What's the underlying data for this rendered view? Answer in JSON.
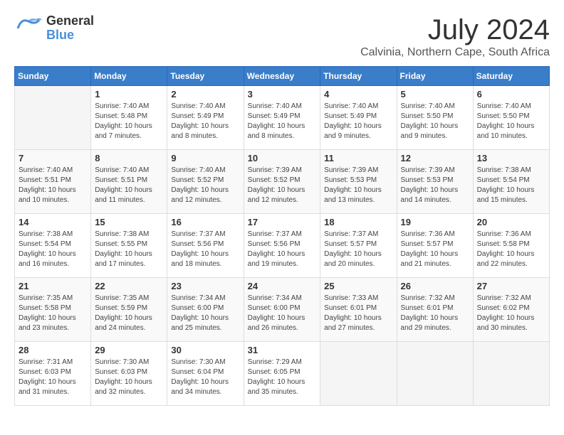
{
  "logo": {
    "general": "General",
    "blue": "Blue"
  },
  "title": {
    "month_year": "July 2024",
    "location": "Calvinia, Northern Cape, South Africa"
  },
  "headers": [
    "Sunday",
    "Monday",
    "Tuesday",
    "Wednesday",
    "Thursday",
    "Friday",
    "Saturday"
  ],
  "weeks": [
    [
      {
        "day": "",
        "info": ""
      },
      {
        "day": "1",
        "info": "Sunrise: 7:40 AM\nSunset: 5:48 PM\nDaylight: 10 hours\nand 7 minutes."
      },
      {
        "day": "2",
        "info": "Sunrise: 7:40 AM\nSunset: 5:49 PM\nDaylight: 10 hours\nand 8 minutes."
      },
      {
        "day": "3",
        "info": "Sunrise: 7:40 AM\nSunset: 5:49 PM\nDaylight: 10 hours\nand 8 minutes."
      },
      {
        "day": "4",
        "info": "Sunrise: 7:40 AM\nSunset: 5:49 PM\nDaylight: 10 hours\nand 9 minutes."
      },
      {
        "day": "5",
        "info": "Sunrise: 7:40 AM\nSunset: 5:50 PM\nDaylight: 10 hours\nand 9 minutes."
      },
      {
        "day": "6",
        "info": "Sunrise: 7:40 AM\nSunset: 5:50 PM\nDaylight: 10 hours\nand 10 minutes."
      }
    ],
    [
      {
        "day": "7",
        "info": "Sunrise: 7:40 AM\nSunset: 5:51 PM\nDaylight: 10 hours\nand 10 minutes."
      },
      {
        "day": "8",
        "info": "Sunrise: 7:40 AM\nSunset: 5:51 PM\nDaylight: 10 hours\nand 11 minutes."
      },
      {
        "day": "9",
        "info": "Sunrise: 7:40 AM\nSunset: 5:52 PM\nDaylight: 10 hours\nand 12 minutes."
      },
      {
        "day": "10",
        "info": "Sunrise: 7:39 AM\nSunset: 5:52 PM\nDaylight: 10 hours\nand 12 minutes."
      },
      {
        "day": "11",
        "info": "Sunrise: 7:39 AM\nSunset: 5:53 PM\nDaylight: 10 hours\nand 13 minutes."
      },
      {
        "day": "12",
        "info": "Sunrise: 7:39 AM\nSunset: 5:53 PM\nDaylight: 10 hours\nand 14 minutes."
      },
      {
        "day": "13",
        "info": "Sunrise: 7:38 AM\nSunset: 5:54 PM\nDaylight: 10 hours\nand 15 minutes."
      }
    ],
    [
      {
        "day": "14",
        "info": "Sunrise: 7:38 AM\nSunset: 5:54 PM\nDaylight: 10 hours\nand 16 minutes."
      },
      {
        "day": "15",
        "info": "Sunrise: 7:38 AM\nSunset: 5:55 PM\nDaylight: 10 hours\nand 17 minutes."
      },
      {
        "day": "16",
        "info": "Sunrise: 7:37 AM\nSunset: 5:56 PM\nDaylight: 10 hours\nand 18 minutes."
      },
      {
        "day": "17",
        "info": "Sunrise: 7:37 AM\nSunset: 5:56 PM\nDaylight: 10 hours\nand 19 minutes."
      },
      {
        "day": "18",
        "info": "Sunrise: 7:37 AM\nSunset: 5:57 PM\nDaylight: 10 hours\nand 20 minutes."
      },
      {
        "day": "19",
        "info": "Sunrise: 7:36 AM\nSunset: 5:57 PM\nDaylight: 10 hours\nand 21 minutes."
      },
      {
        "day": "20",
        "info": "Sunrise: 7:36 AM\nSunset: 5:58 PM\nDaylight: 10 hours\nand 22 minutes."
      }
    ],
    [
      {
        "day": "21",
        "info": "Sunrise: 7:35 AM\nSunset: 5:58 PM\nDaylight: 10 hours\nand 23 minutes."
      },
      {
        "day": "22",
        "info": "Sunrise: 7:35 AM\nSunset: 5:59 PM\nDaylight: 10 hours\nand 24 minutes."
      },
      {
        "day": "23",
        "info": "Sunrise: 7:34 AM\nSunset: 6:00 PM\nDaylight: 10 hours\nand 25 minutes."
      },
      {
        "day": "24",
        "info": "Sunrise: 7:34 AM\nSunset: 6:00 PM\nDaylight: 10 hours\nand 26 minutes."
      },
      {
        "day": "25",
        "info": "Sunrise: 7:33 AM\nSunset: 6:01 PM\nDaylight: 10 hours\nand 27 minutes."
      },
      {
        "day": "26",
        "info": "Sunrise: 7:32 AM\nSunset: 6:01 PM\nDaylight: 10 hours\nand 29 minutes."
      },
      {
        "day": "27",
        "info": "Sunrise: 7:32 AM\nSunset: 6:02 PM\nDaylight: 10 hours\nand 30 minutes."
      }
    ],
    [
      {
        "day": "28",
        "info": "Sunrise: 7:31 AM\nSunset: 6:03 PM\nDaylight: 10 hours\nand 31 minutes."
      },
      {
        "day": "29",
        "info": "Sunrise: 7:30 AM\nSunset: 6:03 PM\nDaylight: 10 hours\nand 32 minutes."
      },
      {
        "day": "30",
        "info": "Sunrise: 7:30 AM\nSunset: 6:04 PM\nDaylight: 10 hours\nand 34 minutes."
      },
      {
        "day": "31",
        "info": "Sunrise: 7:29 AM\nSunset: 6:05 PM\nDaylight: 10 hours\nand 35 minutes."
      },
      {
        "day": "",
        "info": ""
      },
      {
        "day": "",
        "info": ""
      },
      {
        "day": "",
        "info": ""
      }
    ]
  ]
}
